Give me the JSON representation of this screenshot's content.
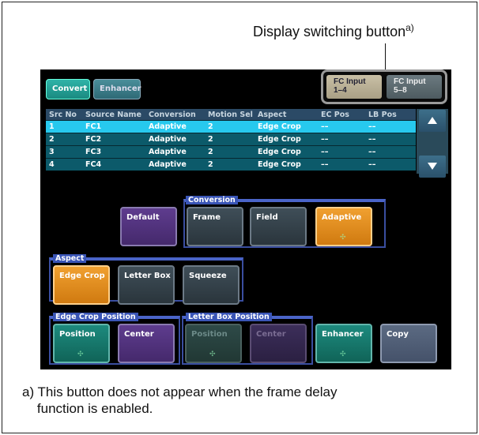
{
  "callout": {
    "text": "Display switching button",
    "sup": "a)"
  },
  "tabs": {
    "convert": "Convert",
    "enhancer": "Enhancer"
  },
  "fc": {
    "input1": "FC Input\n1–4",
    "input2": "FC Input\n5–8"
  },
  "table": {
    "headers": [
      "Src No",
      "Source Name",
      "Conversion",
      "Motion Sel",
      "Aspect",
      "EC Pos",
      "LB Pos"
    ],
    "rows": [
      [
        "1",
        "FC1",
        "Adaptive",
        "2",
        "Edge Crop",
        "––",
        "––"
      ],
      [
        "2",
        "FC2",
        "Adaptive",
        "2",
        "Edge Crop",
        "––",
        "––"
      ],
      [
        "3",
        "FC3",
        "Adaptive",
        "2",
        "Edge Crop",
        "––",
        "––"
      ],
      [
        "4",
        "FC4",
        "Adaptive",
        "2",
        "Edge Crop",
        "––",
        "––"
      ]
    ],
    "selected_row": 1
  },
  "groups": {
    "conversion": "Conversion",
    "aspect": "Aspect",
    "edge_crop_position": "Edge Crop Position",
    "letter_box_position": "Letter Box Position"
  },
  "buttons": {
    "default": "Default",
    "frame": "Frame",
    "field": "Field",
    "adaptive": "Adaptive",
    "edge_crop": "Edge Crop",
    "letter_box": "Letter Box",
    "squeeze": "Squeeze",
    "ec_position": "Position",
    "ec_center": "Center",
    "lb_position": "Position",
    "lb_center": "Center",
    "enhancer": "Enhancer",
    "copy": "Copy"
  },
  "footnote": "a) This button does not appear when the frame delay\n    function is enabled.",
  "colors": {
    "accent_teal": "#1d8a7e",
    "accent_orange": "#f0a030",
    "selected_row": "#27c9ee"
  }
}
